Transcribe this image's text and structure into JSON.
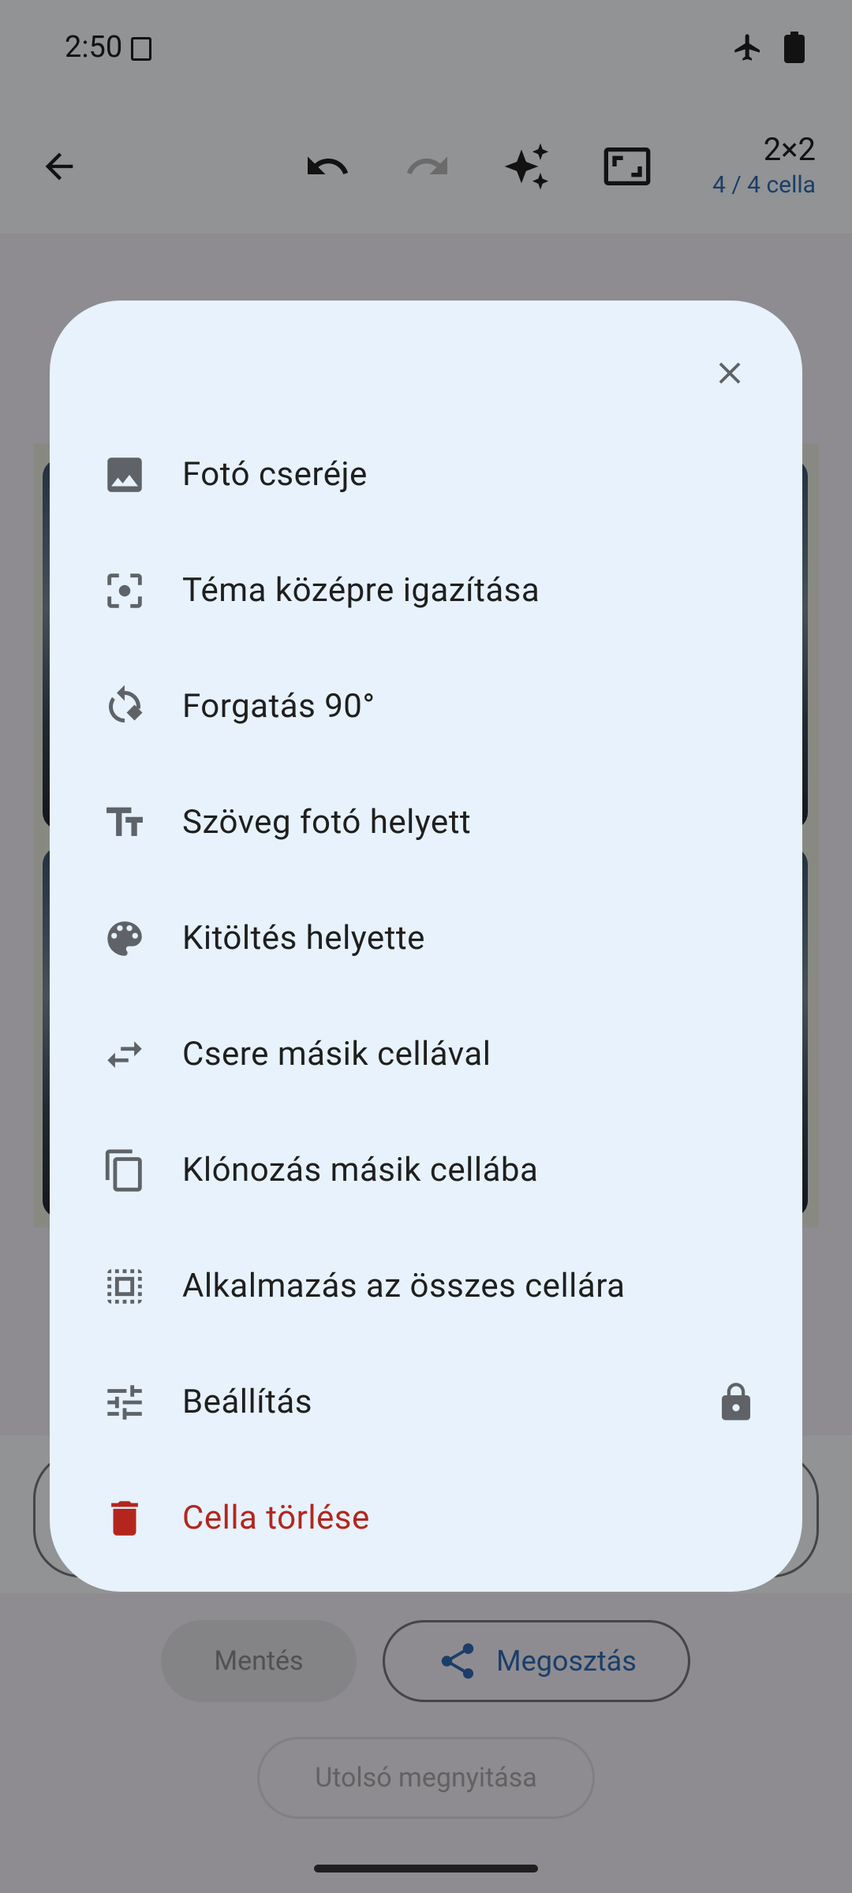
{
  "status_bar": {
    "time": "2:50"
  },
  "toolbar": {
    "grid_size": "2×2",
    "cells": "4 / 4 cella"
  },
  "buttons": {
    "save": "Mentés",
    "share": "Megosztás",
    "last_open": "Utolsó megnyitása"
  },
  "dialog": {
    "items": [
      {
        "label": "Fotó cseréje",
        "icon": "image-icon"
      },
      {
        "label": "Téma középre igazítása",
        "icon": "center-focus-icon"
      },
      {
        "label": "Forgatás 90°",
        "icon": "rotate-icon"
      },
      {
        "label": "Szöveg fotó helyett",
        "icon": "text-icon"
      },
      {
        "label": "Kitöltés helyette",
        "icon": "palette-icon"
      },
      {
        "label": "Csere másik cellával",
        "icon": "swap-icon"
      },
      {
        "label": "Klónozás másik cellába",
        "icon": "copy-icon"
      },
      {
        "label": "Alkalmazás az összes cellára",
        "icon": "select-all-icon"
      },
      {
        "label": "Beállítás",
        "icon": "tune-icon",
        "locked": true
      },
      {
        "label": "Cella törlése",
        "icon": "delete-icon",
        "danger": true
      }
    ]
  },
  "colors": {
    "accent": "#2f6cb5",
    "danger": "#b3261e",
    "dialog_bg": "#e7f2fc"
  }
}
